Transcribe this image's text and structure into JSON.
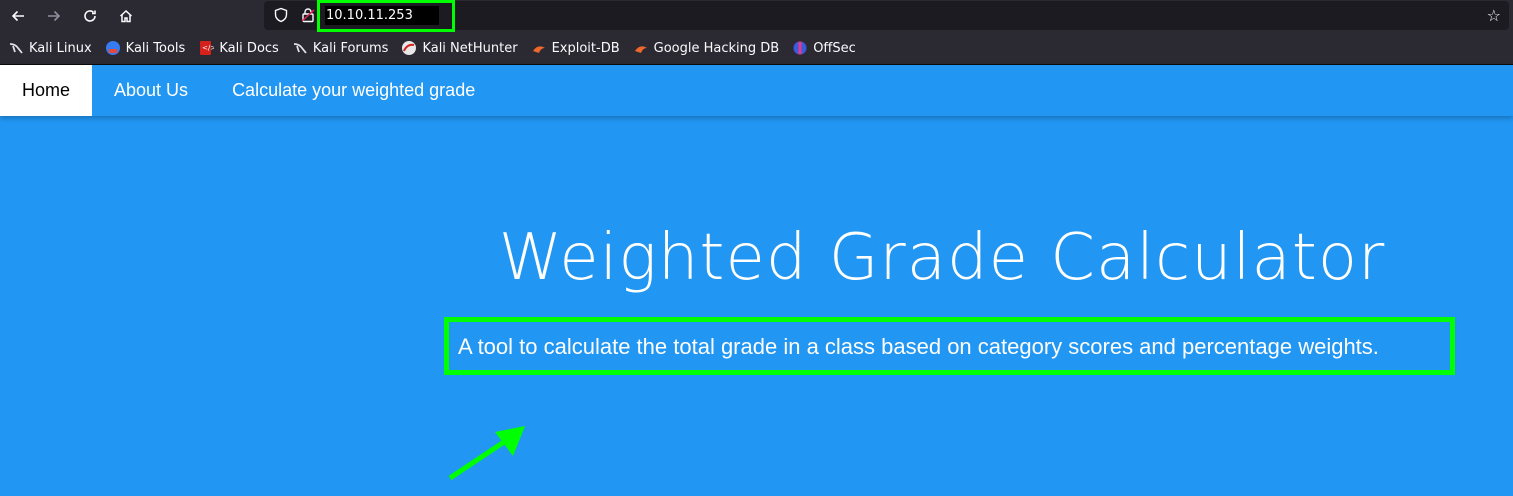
{
  "browser": {
    "url": "10.10.11.253",
    "bookmarks": [
      {
        "label": "Kali Linux",
        "icon": "kali-dragon-icon"
      },
      {
        "label": "Kali Tools",
        "icon": "kali-tools-icon"
      },
      {
        "label": "Kali Docs",
        "icon": "kali-docs-icon"
      },
      {
        "label": "Kali Forums",
        "icon": "kali-dragon-icon"
      },
      {
        "label": "Kali NetHunter",
        "icon": "nethunter-icon"
      },
      {
        "label": "Exploit-DB",
        "icon": "exploit-db-icon"
      },
      {
        "label": "Google Hacking DB",
        "icon": "ghdb-icon"
      },
      {
        "label": "OffSec",
        "icon": "offsec-icon"
      }
    ]
  },
  "nav": {
    "items": [
      {
        "label": "Home",
        "active": true
      },
      {
        "label": "About Us",
        "active": false
      },
      {
        "label": "Calculate your weighted grade",
        "active": false
      }
    ]
  },
  "hero": {
    "title": "Weighted Grade Calculator",
    "subtitle": "A tool to calculate the total grade in a class based on category scores and percentage weights."
  },
  "colors": {
    "page_bg": "#2196f3",
    "annotation": "#00ff00",
    "chrome_bg": "#2b2a33"
  }
}
